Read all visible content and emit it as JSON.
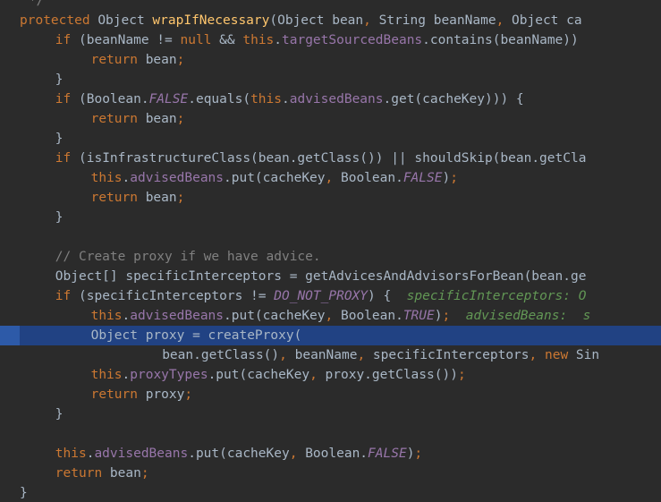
{
  "editor": {
    "lines": [
      {
        "tokens": [
          {
            "t": "*/",
            "c": "cmt"
          }
        ],
        "indent": 1
      },
      {
        "tokens": [
          {
            "t": "protected ",
            "c": "kw"
          },
          {
            "t": "Object ",
            "c": "plain"
          },
          {
            "t": "wrapIfNecessary",
            "c": "fn"
          },
          {
            "t": "(Object bean",
            "c": "plain"
          },
          {
            "t": ", ",
            "c": "punct"
          },
          {
            "t": "String beanName",
            "c": "plain"
          },
          {
            "t": ", ",
            "c": "punct"
          },
          {
            "t": "Object ca",
            "c": "plain"
          }
        ],
        "indent": 0
      },
      {
        "tokens": [
          {
            "t": "if ",
            "c": "kw"
          },
          {
            "t": "(beanName != ",
            "c": "plain"
          },
          {
            "t": "null ",
            "c": "kw"
          },
          {
            "t": "&& ",
            "c": "plain"
          },
          {
            "t": "this",
            "c": "kw"
          },
          {
            "t": ".",
            "c": "plain"
          },
          {
            "t": "targetSourcedBeans",
            "c": "field"
          },
          {
            "t": ".contains(beanName))",
            "c": "plain"
          }
        ],
        "indent": 4
      },
      {
        "tokens": [
          {
            "t": "return ",
            "c": "kw"
          },
          {
            "t": "bean",
            "c": "plain"
          },
          {
            "t": ";",
            "c": "punct"
          }
        ],
        "indent": 8
      },
      {
        "tokens": [
          {
            "t": "}",
            "c": "plain"
          }
        ],
        "indent": 4
      },
      {
        "tokens": [
          {
            "t": "if ",
            "c": "kw"
          },
          {
            "t": "(Boolean.",
            "c": "plain"
          },
          {
            "t": "FALSE",
            "c": "const"
          },
          {
            "t": ".equals(",
            "c": "plain"
          },
          {
            "t": "this",
            "c": "kw"
          },
          {
            "t": ".",
            "c": "plain"
          },
          {
            "t": "advisedBeans",
            "c": "field"
          },
          {
            "t": ".get(cacheKey))) {",
            "c": "plain"
          }
        ],
        "indent": 4
      },
      {
        "tokens": [
          {
            "t": "return ",
            "c": "kw"
          },
          {
            "t": "bean",
            "c": "plain"
          },
          {
            "t": ";",
            "c": "punct"
          }
        ],
        "indent": 8
      },
      {
        "tokens": [
          {
            "t": "}",
            "c": "plain"
          }
        ],
        "indent": 4
      },
      {
        "tokens": [
          {
            "t": "if ",
            "c": "kw"
          },
          {
            "t": "(isInfrastructureClass(bean.getClass()) || shouldSkip(bean.getCla",
            "c": "plain"
          }
        ],
        "indent": 4
      },
      {
        "tokens": [
          {
            "t": "this",
            "c": "kw"
          },
          {
            "t": ".",
            "c": "plain"
          },
          {
            "t": "advisedBeans",
            "c": "field"
          },
          {
            "t": ".put(cacheKey",
            "c": "plain"
          },
          {
            "t": ", ",
            "c": "punct"
          },
          {
            "t": "Boolean.",
            "c": "plain"
          },
          {
            "t": "FALSE",
            "c": "const"
          },
          {
            "t": ")",
            "c": "plain"
          },
          {
            "t": ";",
            "c": "punct"
          }
        ],
        "indent": 8
      },
      {
        "tokens": [
          {
            "t": "return ",
            "c": "kw"
          },
          {
            "t": "bean",
            "c": "plain"
          },
          {
            "t": ";",
            "c": "punct"
          }
        ],
        "indent": 8
      },
      {
        "tokens": [
          {
            "t": "}",
            "c": "plain"
          }
        ],
        "indent": 4
      },
      {
        "tokens": [],
        "indent": 0
      },
      {
        "tokens": [
          {
            "t": "// Create proxy if we have advice.",
            "c": "cmt"
          }
        ],
        "indent": 4
      },
      {
        "tokens": [
          {
            "t": "Object[] specificInterceptors = getAdvicesAndAdvisorsForBean(bean.ge",
            "c": "plain"
          }
        ],
        "indent": 4
      },
      {
        "tokens": [
          {
            "t": "if ",
            "c": "kw"
          },
          {
            "t": "(specificInterceptors != ",
            "c": "plain"
          },
          {
            "t": "DO_NOT_PROXY",
            "c": "const"
          },
          {
            "t": ") {  ",
            "c": "plain"
          },
          {
            "t": "specificInterceptors: O",
            "c": "hint"
          }
        ],
        "indent": 4
      },
      {
        "tokens": [
          {
            "t": "this",
            "c": "kw"
          },
          {
            "t": ".",
            "c": "plain"
          },
          {
            "t": "advisedBeans",
            "c": "field"
          },
          {
            "t": ".put(cacheKey",
            "c": "plain"
          },
          {
            "t": ", ",
            "c": "punct"
          },
          {
            "t": "Boolean.",
            "c": "plain"
          },
          {
            "t": "TRUE",
            "c": "const"
          },
          {
            "t": ")",
            "c": "plain"
          },
          {
            "t": ";  ",
            "c": "punct"
          },
          {
            "t": "advisedBeans:  s",
            "c": "hint"
          }
        ],
        "indent": 8
      },
      {
        "tokens": [
          {
            "t": "Object proxy = createProxy(",
            "c": "plain"
          }
        ],
        "indent": 8,
        "highlight": true
      },
      {
        "tokens": [
          {
            "t": "bean.getClass()",
            "c": "plain"
          },
          {
            "t": ", ",
            "c": "punct"
          },
          {
            "t": "beanName",
            "c": "plain"
          },
          {
            "t": ", ",
            "c": "punct"
          },
          {
            "t": "specificInterceptors",
            "c": "plain"
          },
          {
            "t": ", ",
            "c": "punct"
          },
          {
            "t": "new ",
            "c": "kw"
          },
          {
            "t": "Sin",
            "c": "plain"
          }
        ],
        "indent": 16
      },
      {
        "tokens": [
          {
            "t": "this",
            "c": "kw"
          },
          {
            "t": ".",
            "c": "plain"
          },
          {
            "t": "proxyTypes",
            "c": "field"
          },
          {
            "t": ".put(cacheKey",
            "c": "plain"
          },
          {
            "t": ", ",
            "c": "punct"
          },
          {
            "t": "proxy.getClass())",
            "c": "plain"
          },
          {
            "t": ";",
            "c": "punct"
          }
        ],
        "indent": 8
      },
      {
        "tokens": [
          {
            "t": "return ",
            "c": "kw"
          },
          {
            "t": "proxy",
            "c": "plain"
          },
          {
            "t": ";",
            "c": "punct"
          }
        ],
        "indent": 8
      },
      {
        "tokens": [
          {
            "t": "}",
            "c": "plain"
          }
        ],
        "indent": 4
      },
      {
        "tokens": [],
        "indent": 0
      },
      {
        "tokens": [
          {
            "t": "this",
            "c": "kw"
          },
          {
            "t": ".",
            "c": "plain"
          },
          {
            "t": "advisedBeans",
            "c": "field"
          },
          {
            "t": ".put(cacheKey",
            "c": "plain"
          },
          {
            "t": ", ",
            "c": "punct"
          },
          {
            "t": "Boolean.",
            "c": "plain"
          },
          {
            "t": "FALSE",
            "c": "const"
          },
          {
            "t": ")",
            "c": "plain"
          },
          {
            "t": ";",
            "c": "punct"
          }
        ],
        "indent": 4
      },
      {
        "tokens": [
          {
            "t": "return ",
            "c": "kw"
          },
          {
            "t": "bean",
            "c": "plain"
          },
          {
            "t": ";",
            "c": "punct"
          }
        ],
        "indent": 4
      },
      {
        "tokens": [
          {
            "t": "}",
            "c": "plain"
          }
        ],
        "indent": 0
      }
    ]
  }
}
